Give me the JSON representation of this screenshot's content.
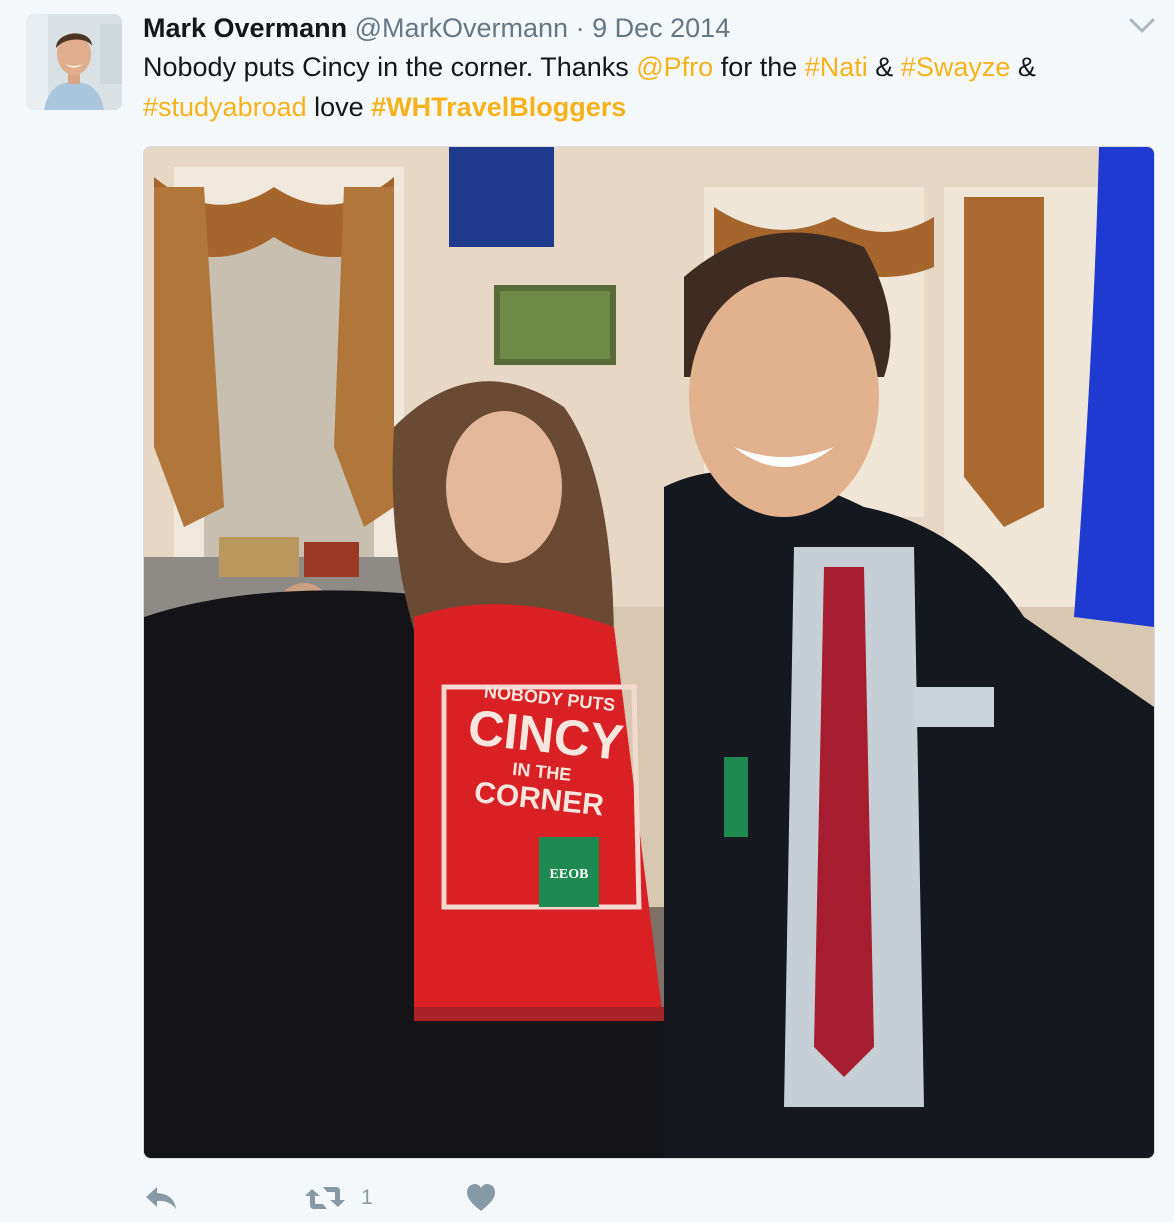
{
  "tweet": {
    "author_name": "Mark Overmann",
    "author_handle": "@MarkOvermann",
    "separator": "·",
    "date": "9 Dec 2014",
    "text": {
      "part1": "Nobody puts Cincy in the corner. Thanks ",
      "mention": "@Pfro",
      "part2": " for the ",
      "hashtag1": "#Nati",
      "part3": " & ",
      "hashtag2": "#Swayze",
      "part4": " & ",
      "hashtag3": "#studyabroad",
      "part5": " love ",
      "hashtag4": "#WHTravelBloggers"
    },
    "media_alt": "Photo of two people posing in an ornate room",
    "shirt_text": {
      "line1": "NOBODY PUTS",
      "line2": "CINCY",
      "line3": "IN THE",
      "line4": "CORNER"
    },
    "badge_text": "EEOB",
    "actions": {
      "reply_icon": "reply-icon",
      "retweet_icon": "retweet-icon",
      "retweet_count": "1",
      "like_icon": "heart-icon",
      "menu_icon": "chevron-down-icon"
    },
    "colors": {
      "link": "#f6b21b",
      "text": "#14171a",
      "muted": "#657786",
      "background": "#f5f8fa"
    }
  }
}
